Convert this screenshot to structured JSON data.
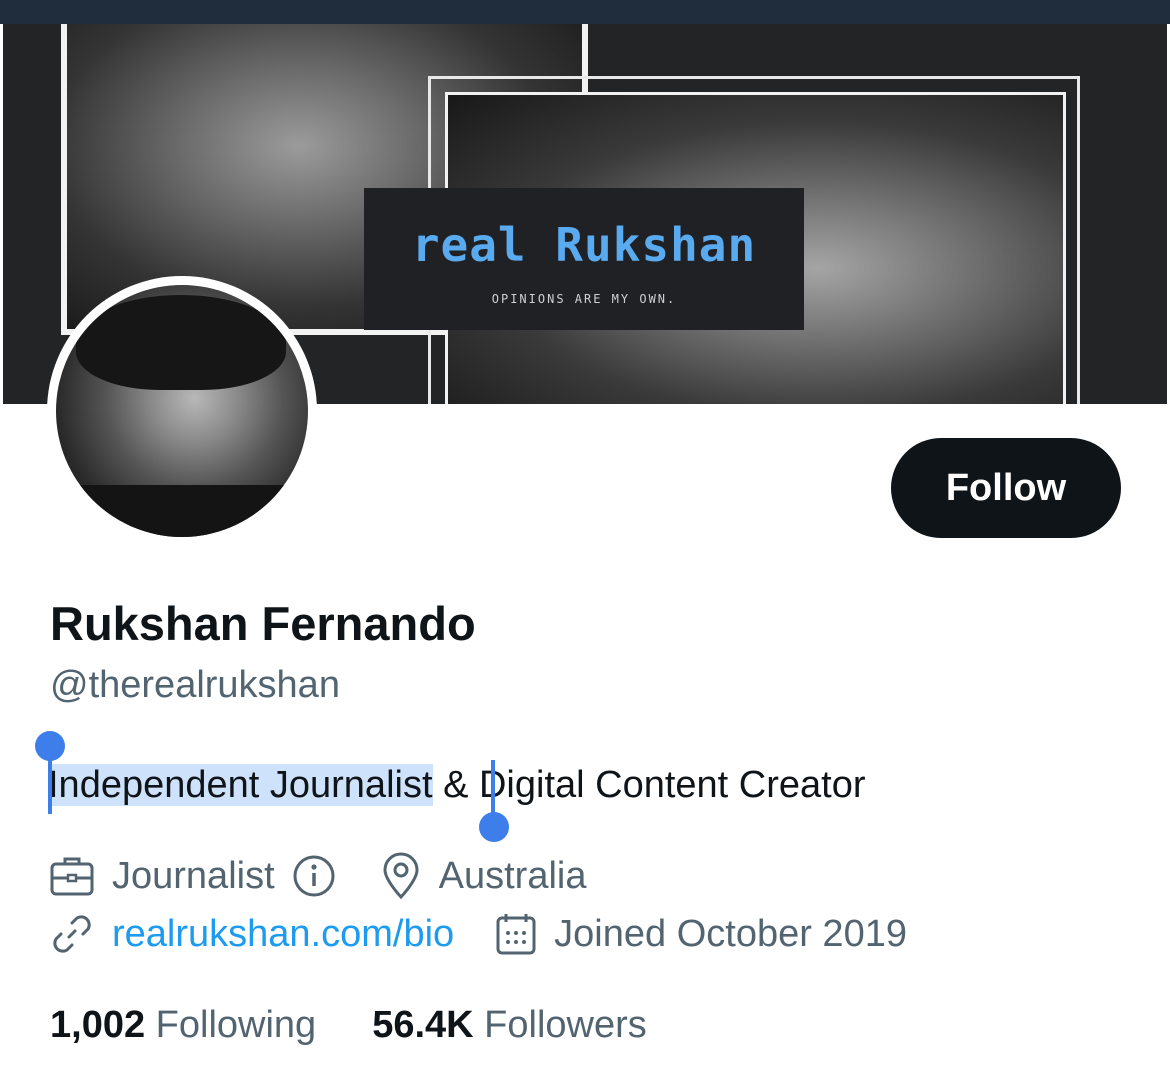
{
  "banner": {
    "title": "real Rukshan",
    "subtitle": "OPINIONS ARE MY OWN."
  },
  "profile": {
    "follow_label": "Follow",
    "display_name": "Rukshan Fernando",
    "handle": "@therealrukshan",
    "bio_selected": "Independent Journalist",
    "bio_rest": " & Digital Content Creator",
    "category": "Journalist",
    "location": "Australia",
    "website": "realrukshan.com/bio",
    "joined": "Joined October 2019"
  },
  "stats": {
    "following_count": "1,002",
    "following_label": "Following",
    "followers_count": "56.4K",
    "followers_label": "Followers"
  },
  "icons": {
    "category": "briefcase-icon",
    "info": "info-icon",
    "location": "location-pin-icon",
    "website": "link-icon",
    "joined": "calendar-icon"
  },
  "colors": {
    "text_primary": "#0f1419",
    "text_secondary": "#536471",
    "link": "#1d9bf0",
    "selection": "#cfe2fb",
    "selection_handle": "#3d7eea",
    "banner_title": "#5aaaf0",
    "follow_button_bg": "#0f1419"
  }
}
